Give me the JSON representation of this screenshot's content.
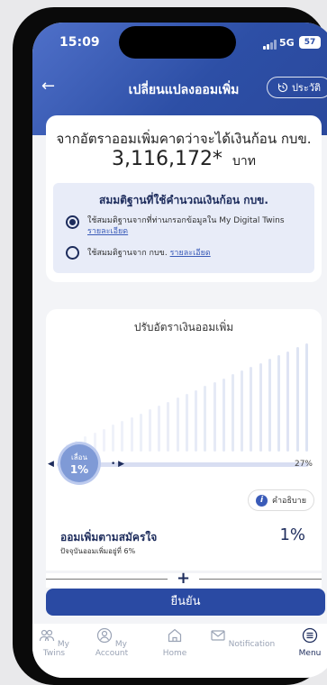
{
  "status": {
    "time": "15:09",
    "network": "5G",
    "battery": "57"
  },
  "topbar": {
    "back_icon": "arrow-left-icon",
    "title": "เปลี่ยนแปลงออมเพิ่ม",
    "history_label": "ประวัติ"
  },
  "estimate": {
    "label": "จากอัตราออมเพิ่มคาดว่าจะได้เงินก้อน กบข.",
    "amount": "3,116,172*",
    "unit": "บาท"
  },
  "assumption": {
    "title": "สมมติฐานที่ใช้คำนวณเงินก้อน กบข.",
    "option1_text": "ใช้สมมติฐานจากที่ท่านกรอกข้อมูลใน My Digital Twins",
    "option1_link": "รายละเอียด",
    "option2_text": "ใช้สมมติฐานจาก กบข.",
    "option2_link": "รายละเอียด",
    "selected": 1
  },
  "adjust": {
    "title": "ปรับอัตราเงินออมเพิ่ม",
    "slider_hint": "เลื่อน",
    "current_value": "1%",
    "current_fraction": 0.04,
    "max_label": "27%"
  },
  "explain_label": "คำอธิบาย",
  "voluntary": {
    "title": "ออมเพิ่มตามสมัครใจ",
    "subtitle": "ปัจจุบันออมเพิ่มอยู่ที่ 6%",
    "value": "1%"
  },
  "plus_symbol": "+",
  "confirm_label": "ยืนยัน",
  "tabs": [
    {
      "label": "My Twins",
      "icon": "people-icon"
    },
    {
      "label": "My Account",
      "icon": "user-icon"
    },
    {
      "label": "Home",
      "icon": "home-icon"
    },
    {
      "label": "Notification",
      "icon": "mail-icon"
    },
    {
      "label": "Menu",
      "icon": "menu-icon"
    }
  ],
  "colors": {
    "primary": "#2a4aa3",
    "header": "#3d5fb8",
    "navy": "#1d2c5c"
  }
}
